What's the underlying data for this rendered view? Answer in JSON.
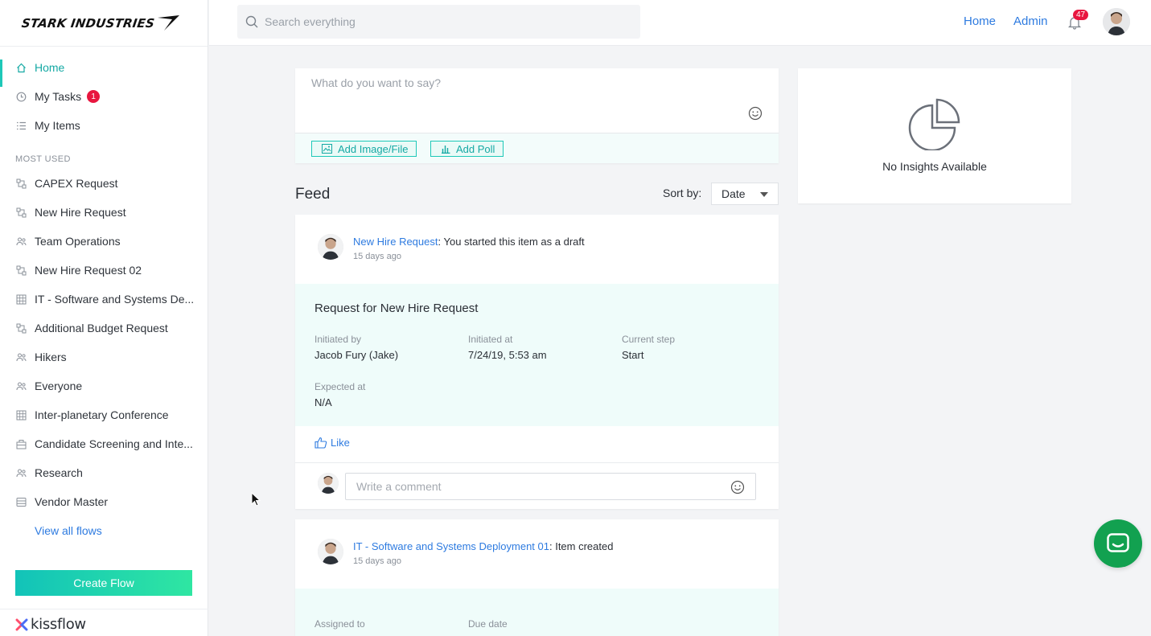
{
  "brand": {
    "name": "STARK INDUSTRIES",
    "footer_logo": "kissflow"
  },
  "sidebar": {
    "top_items": [
      {
        "label": "Home",
        "icon": "home-icon",
        "active": true
      },
      {
        "label": "My Tasks",
        "icon": "clock-icon",
        "badge": "1"
      },
      {
        "label": "My Items",
        "icon": "list-icon"
      }
    ],
    "section_label": "MOST USED",
    "flows": [
      {
        "label": "CAPEX Request",
        "icon": "process-icon"
      },
      {
        "label": "New Hire Request",
        "icon": "process-icon"
      },
      {
        "label": "Team Operations",
        "icon": "people-icon"
      },
      {
        "label": "New Hire Request 02",
        "icon": "process-icon"
      },
      {
        "label": "IT - Software and Systems De...",
        "icon": "grid-icon"
      },
      {
        "label": "Additional Budget Request",
        "icon": "process-icon"
      },
      {
        "label": "Hikers",
        "icon": "people-icon"
      },
      {
        "label": "Everyone",
        "icon": "people-icon"
      },
      {
        "label": "Inter-planetary Conference",
        "icon": "grid-icon"
      },
      {
        "label": "Candidate Screening and Inte...",
        "icon": "case-icon"
      },
      {
        "label": "Research",
        "icon": "people-icon"
      },
      {
        "label": "Vendor Master",
        "icon": "database-icon"
      }
    ],
    "view_all": "View all flows",
    "create_button": "Create Flow"
  },
  "header": {
    "search_placeholder": "Search everything",
    "links": [
      "Home",
      "Admin"
    ],
    "notification_count": "47"
  },
  "composer": {
    "placeholder": "What do you want to say?",
    "add_image": "Add Image/File",
    "add_poll": "Add Poll"
  },
  "feed": {
    "title": "Feed",
    "sort_label": "Sort by:",
    "sort_value": "Date",
    "cards": [
      {
        "link": "New Hire Request",
        "action": ": You started this item as a draft",
        "time": "15 days ago",
        "detail_title": "Request for New Hire Request",
        "fields": [
          {
            "label": "Initiated by",
            "value": "Jacob Fury (Jake)"
          },
          {
            "label": "Initiated at",
            "value": "7/24/19, 5:53 am"
          },
          {
            "label": "Current step",
            "value": "Start"
          },
          {
            "label": "Expected at",
            "value": "N/A"
          }
        ],
        "like": "Like",
        "comment_placeholder": "Write a comment"
      },
      {
        "link": "IT - Software and Systems Deployment 01",
        "action": ": Item created",
        "time": "15 days ago",
        "fields": [
          {
            "label": "Assigned to"
          },
          {
            "label": "Due date"
          }
        ]
      }
    ]
  },
  "insights": {
    "text": "No Insights Available"
  },
  "colors": {
    "accent": "#1ec8b8",
    "link": "#2e7be0",
    "badge": "#e8163f",
    "chat": "#12a150"
  }
}
